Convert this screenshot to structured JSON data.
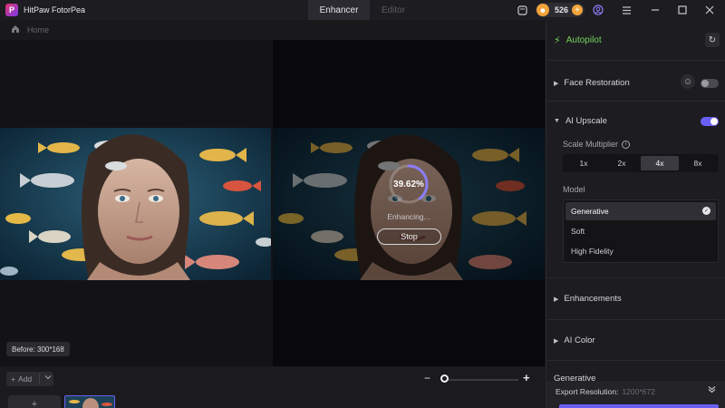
{
  "app": {
    "name": "HitPaw FotorPea",
    "logo_letter": "P"
  },
  "tabs": [
    {
      "label": "Enhancer",
      "active": true
    },
    {
      "label": "Editor",
      "active": false
    }
  ],
  "titlebar": {
    "credits": "526",
    "icons": [
      "message-icon",
      "coin-icon",
      "plus-icon",
      "user-icon",
      "menu-icon",
      "minimize-icon",
      "maximize-icon",
      "close-icon"
    ]
  },
  "breadcrumb": {
    "home": "Home"
  },
  "preview": {
    "progress_text": "39.62%",
    "progress_value": 0.3962,
    "status": "Enhancing...",
    "stop_label": "Stop",
    "before_label": "Before: 300*168"
  },
  "bottom": {
    "add_label": "Add",
    "add_plus": "+",
    "thumb_add": "+"
  },
  "panel": {
    "autopilot": "Autopilot",
    "face_restoration": "Face Restoration",
    "ai_upscale": "AI Upscale",
    "scale_multiplier": "Scale Multiplier",
    "scales": [
      "1x",
      "2x",
      "4x",
      "8x"
    ],
    "active_scale": "4x",
    "model_label": "Model",
    "models": [
      "Generative",
      "Soft",
      "High Fidelity"
    ],
    "selected_model": "Generative",
    "enhancements": "Enhancements",
    "ai_color": "AI Color",
    "generative": "Generative",
    "export_label": "Export Resolution:",
    "export_value": "1200*672"
  },
  "colors": {
    "accent": "#6a5ff5",
    "autopilot": "#73d05a",
    "credits": "#f2a33a",
    "background": "#141416"
  }
}
